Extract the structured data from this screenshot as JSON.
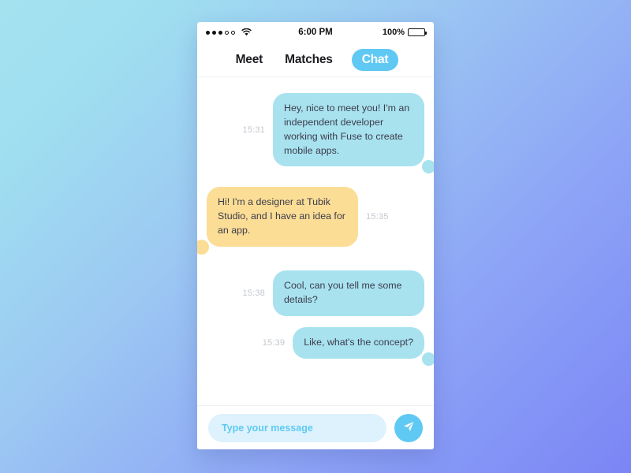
{
  "status_bar": {
    "signal_dots_filled": 3,
    "signal_dots_total": 5,
    "wifi_icon": "wifi-icon",
    "time": "6:00 PM",
    "battery_percent": "100%",
    "battery_icon": "battery-full-icon"
  },
  "nav": {
    "tabs": [
      {
        "label": "Meet",
        "active": false
      },
      {
        "label": "Matches",
        "active": false
      },
      {
        "label": "Chat",
        "active": true
      }
    ],
    "active_pill_color": "#5fc9f3"
  },
  "chat": {
    "messages": [
      {
        "time": "15:31",
        "side": "out",
        "color": "blue",
        "text": "Hey, nice to meet you! I'm an independent developer working with Fuse to create mobile apps.",
        "has_tail": true
      },
      {
        "time": "15:35",
        "side": "in",
        "color": "yellow",
        "text": "Hi! I'm a designer at Tubik Studio, and I have an idea for an app.",
        "has_tail": true
      },
      {
        "time": "15:38",
        "side": "out",
        "color": "blue",
        "text": "Cool, can you tell me some details?",
        "has_tail": false
      },
      {
        "time": "15:39",
        "side": "out",
        "color": "blue",
        "text": "Like, what's the concept?",
        "has_tail": true
      }
    ],
    "bubble_colors": {
      "blue": "#a8e2ef",
      "yellow": "#fbdd96"
    },
    "timestamp_color": "#c3c8ce"
  },
  "input_bar": {
    "placeholder": "Type your message",
    "value": "",
    "field_bg": "#ddf2fc",
    "field_text_color": "#5fc9f3",
    "send_icon": "paper-plane-icon",
    "send_button_color": "#5fc9f3"
  },
  "background": {
    "gradient_from": "#a5e2f0",
    "gradient_to": "#7b85f5"
  }
}
